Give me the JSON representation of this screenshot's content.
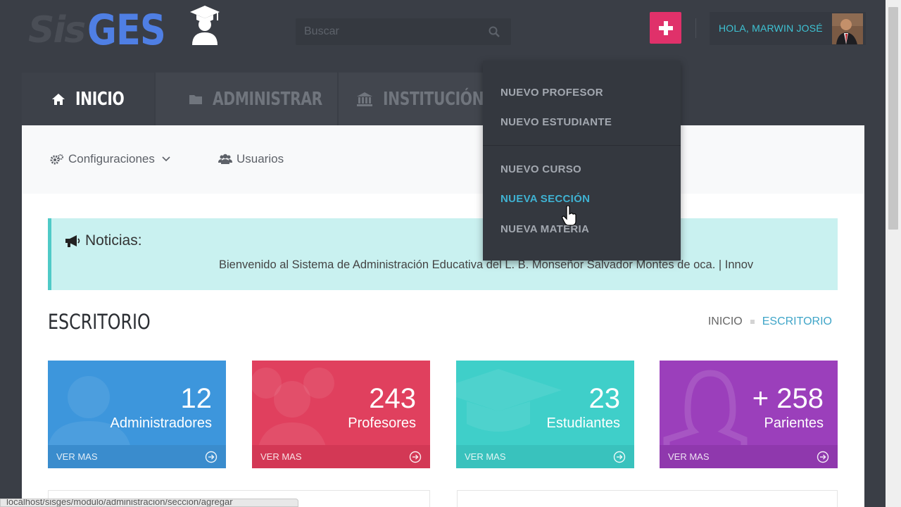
{
  "brand": {
    "sis": "Sis",
    "ges": "GES"
  },
  "search": {
    "placeholder": "Buscar"
  },
  "user": {
    "greeting": "HOLA, MARWIN JOSÉ"
  },
  "nav": {
    "tabs": [
      {
        "label": "INICIO",
        "icon": "home-icon"
      },
      {
        "label": "ADMINISTRAR",
        "icon": "folder-icon"
      },
      {
        "label": "INSTITUCIÓN",
        "icon": "institution-icon"
      }
    ]
  },
  "subnav": {
    "config_label": "Configuraciones",
    "users_label": "Usuarios"
  },
  "dropdown": {
    "items": [
      {
        "label": "NUEVO PROFESOR"
      },
      {
        "label": "NUEVO ESTUDIANTE"
      },
      {
        "label": "NUEVO CURSO"
      },
      {
        "label": "NUEVA SECCIÓN",
        "active": true
      },
      {
        "label": "NUEVA MATERIA"
      }
    ]
  },
  "news": {
    "title": "Noticias:",
    "text": "Bienvenido al Sistema de Administración Educativa del L. B. Monseñor Salvador Montes de oca. | Innov"
  },
  "page": {
    "title": "ESCRITORIO",
    "breadcrumb": {
      "home": "INICIO",
      "current": "ESCRITORIO"
    }
  },
  "cards": [
    {
      "value": "12",
      "label": "Administradores",
      "link": "VER MAS",
      "color": "#3d96dc"
    },
    {
      "value": "243",
      "label": "Profesores",
      "link": "VER MAS",
      "color": "#e0405e"
    },
    {
      "value": "23",
      "label": "Estudiantes",
      "link": "VER MAS",
      "color": "#3fcfc9"
    },
    {
      "value": "+ 258",
      "label": "Parientes",
      "link": "VER MAS",
      "color": "#9b3fbb"
    }
  ],
  "statusbar": {
    "text": "localhost/sisges/modulo/administracion/seccion/agregar"
  },
  "colors": {
    "accent": "#3ec3d4",
    "plus_button": "#e0316a",
    "topbar": "#3a3e46"
  }
}
